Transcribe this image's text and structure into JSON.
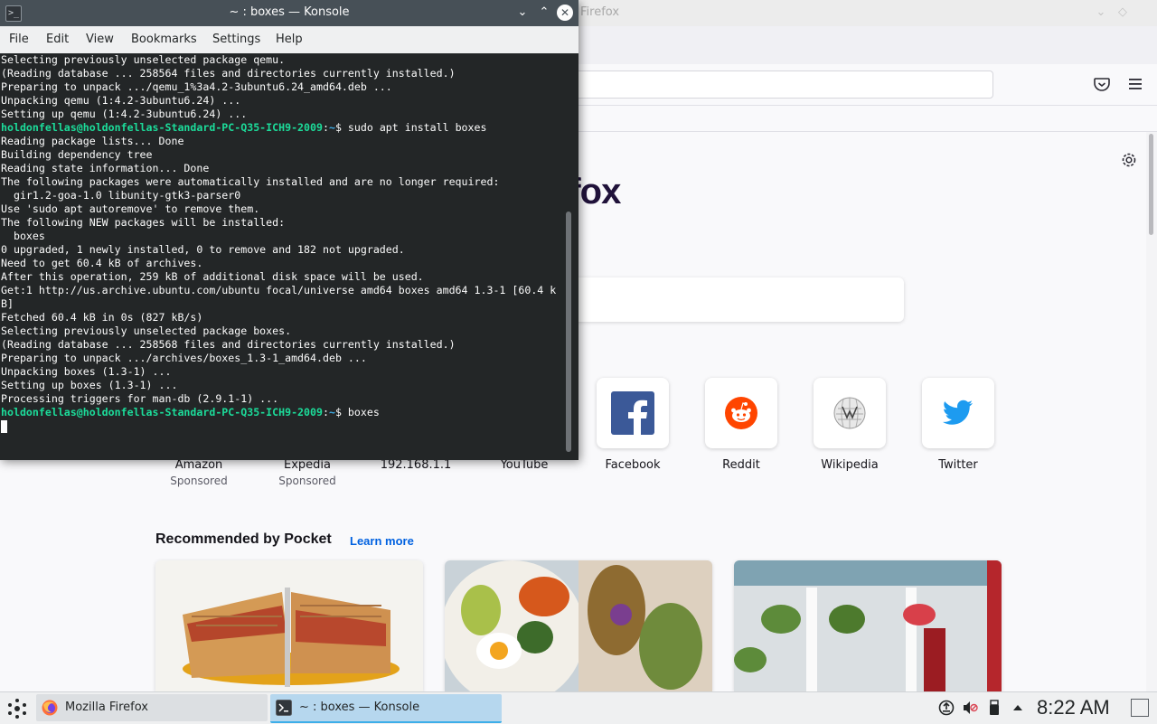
{
  "firefox": {
    "window_title": "Firefox",
    "logo_text": "Firefox",
    "top_sites": [
      {
        "label": "Amazon",
        "sub": "Sponsored",
        "icon": "amazon-icon"
      },
      {
        "label": "Expedia",
        "sub": "Sponsored",
        "icon": "expedia-icon"
      },
      {
        "label": "192.168.1.1",
        "sub": "",
        "icon": "site-icon"
      },
      {
        "label": "YouTube",
        "sub": "",
        "icon": "youtube-icon"
      },
      {
        "label": "Facebook",
        "sub": "",
        "icon": "facebook-icon"
      },
      {
        "label": "Reddit",
        "sub": "",
        "icon": "reddit-icon"
      },
      {
        "label": "Wikipedia",
        "sub": "",
        "icon": "wikipedia-icon"
      },
      {
        "label": "Twitter",
        "sub": "",
        "icon": "twitter-icon"
      }
    ],
    "pocket": {
      "heading": "Recommended by Pocket",
      "learn_more": "Learn more"
    }
  },
  "konsole": {
    "window_title": "~ : boxes — Konsole",
    "app_icon_glyph": ">_",
    "menu": [
      "File",
      "Edit",
      "View",
      "Bookmarks",
      "Settings",
      "Help"
    ],
    "prompt_user": "holdonfellas@holdonfellas-Standard-PC-Q35-ICH9-2009",
    "prompt_path": "~",
    "lines": [
      {
        "text": "Selecting previously unselected package qemu."
      },
      {
        "text": "(Reading database ... 258564 files and directories currently installed.)"
      },
      {
        "text": "Preparing to unpack .../qemu_1%3a4.2-3ubuntu6.24_amd64.deb ..."
      },
      {
        "text": "Unpacking qemu (1:4.2-3ubuntu6.24) ..."
      },
      {
        "text": "Setting up qemu (1:4.2-3ubuntu6.24) ..."
      },
      {
        "prompt": true,
        "text": "$ sudo apt install boxes"
      },
      {
        "text": "Reading package lists... Done"
      },
      {
        "text": "Building dependency tree"
      },
      {
        "text": "Reading state information... Done"
      },
      {
        "text": "The following packages were automatically installed and are no longer required:"
      },
      {
        "text": "  gir1.2-goa-1.0 libunity-gtk3-parser0"
      },
      {
        "text": "Use 'sudo apt autoremove' to remove them."
      },
      {
        "text": "The following NEW packages will be installed:"
      },
      {
        "text": "  boxes"
      },
      {
        "text": "0 upgraded, 1 newly installed, 0 to remove and 182 not upgraded."
      },
      {
        "text": "Need to get 60.4 kB of archives."
      },
      {
        "text": "After this operation, 259 kB of additional disk space will be used."
      },
      {
        "text": "Get:1 http://us.archive.ubuntu.com/ubuntu focal/universe amd64 boxes amd64 1.3-1 [60.4 k"
      },
      {
        "text": "B]"
      },
      {
        "text": "Fetched 60.4 kB in 0s (827 kB/s)"
      },
      {
        "text": "Selecting previously unselected package boxes."
      },
      {
        "text": "(Reading database ... 258568 files and directories currently installed.)"
      },
      {
        "text": "Preparing to unpack .../archives/boxes_1.3-1_amd64.deb ..."
      },
      {
        "text": "Unpacking boxes (1.3-1) ..."
      },
      {
        "text": "Setting up boxes (1.3-1) ..."
      },
      {
        "text": "Processing triggers for man-db (2.9.1-1) ..."
      },
      {
        "prompt": true,
        "text": "$ boxes"
      }
    ]
  },
  "taskbar": {
    "tasks": [
      {
        "label": "Mozilla Firefox",
        "icon": "firefox-icon"
      },
      {
        "label": "~ : boxes — Konsole",
        "icon": "konsole-icon"
      }
    ],
    "clock": "8:22 AM"
  },
  "colors": {
    "konsole_bg": "#232627",
    "prompt_green": "#1cdc9a",
    "prompt_path_blue": "#3daee9",
    "firefox_link_blue": "#0061e0"
  }
}
